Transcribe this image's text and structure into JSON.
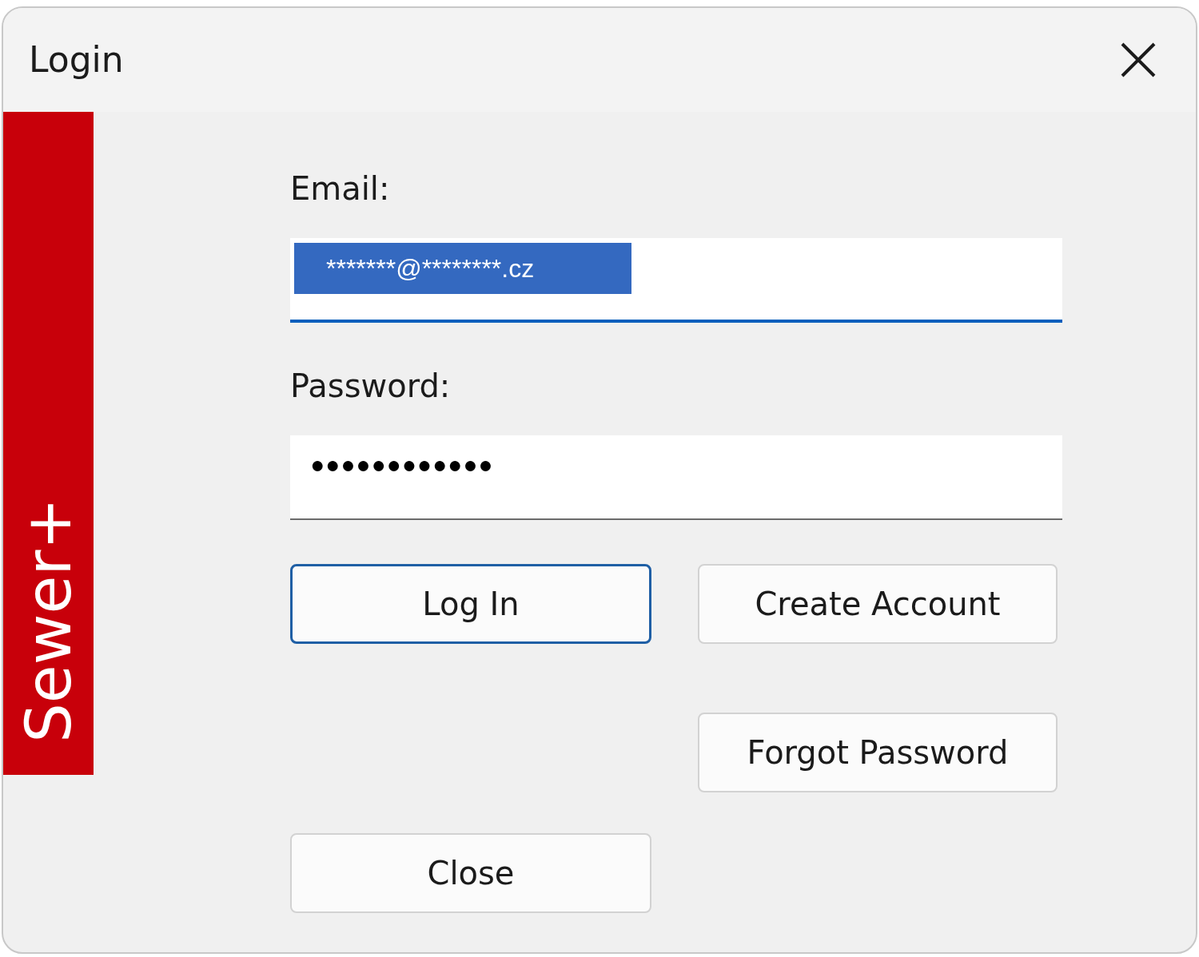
{
  "window": {
    "title": "Login"
  },
  "brand": "Sewer+",
  "fields": [
    {
      "label": "Email:",
      "value": "*******@********.cz",
      "focused": true,
      "text_selected": true
    },
    {
      "label": "Password:",
      "value": "●●●●●●●●●●●●",
      "focused": false,
      "text_selected": false
    }
  ],
  "buttons": [
    {
      "label": "Log In",
      "default": true
    },
    {
      "label": "Create Account",
      "default": false
    },
    {
      "label": "Forgot Password",
      "default": false
    },
    {
      "label": "Close",
      "default": false
    }
  ]
}
